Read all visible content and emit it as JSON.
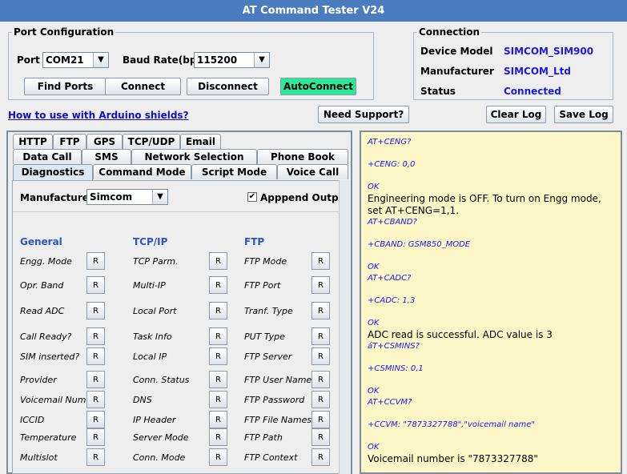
{
  "window": {
    "title": "AT Command Tester V24"
  },
  "port_config": {
    "legend": "Port Configuration",
    "port_label": "Port",
    "port_value": "COM21",
    "baud_label": "Baud Rate(bps)",
    "baud_value": "115200",
    "find_ports": "Find Ports",
    "connect": "Connect",
    "disconnect": "Disconnect",
    "autoconnect": "AutoConnect"
  },
  "connection": {
    "legend": "Connection",
    "device_model_label": "Device Model",
    "device_model_value": "SIMCOM_SIM900",
    "manufacturer_label": "Manufacturer",
    "manufacturer_value": "SIMCOM_Ltd",
    "status_label": "Status",
    "status_value": "Connected"
  },
  "links": {
    "arduino": "How to use with Arduino shields?"
  },
  "buttons": {
    "need_support": "Need Support?",
    "clear_log": "Clear Log",
    "save_log": "Save Log"
  },
  "tabs": {
    "row1": [
      "HTTP",
      "FTP",
      "GPS",
      "TCP/UDP",
      "Email"
    ],
    "row2": [
      "Data Call",
      "SMS",
      "Network Selection",
      "Phone Book"
    ],
    "row3": [
      "Diagnostics",
      "Command Mode",
      "Script Mode",
      "Voice Call"
    ],
    "selected": "Diagnostics"
  },
  "diagnostics": {
    "manufacturer_label": "Manufacturer",
    "manufacturer_value": "Simcom",
    "append_output_label": "Apppend Output",
    "append_output_checked": true,
    "button_label": "R",
    "columns": [
      {
        "header": "General",
        "items": [
          "Engg. Mode",
          "Opr. Band",
          "Read ADC",
          "Call Ready?",
          "SIM inserted?",
          "Provider",
          "Voicemail Num.",
          "ICCID",
          "Temperature",
          "Multislot"
        ]
      },
      {
        "header": "TCP/IP",
        "items": [
          "TCP Parm.",
          "Multi-IP",
          "Local Port",
          "Task Info",
          "Local IP",
          "Conn. Status",
          "DNS",
          "IP Header",
          "Server Mode",
          "Conn. Mode"
        ]
      },
      {
        "header": "FTP",
        "items": [
          "FTP Mode",
          "FTP Port",
          "Tranf. Type",
          "PUT Type",
          "FTP Server",
          "FTP User Name",
          "FTP Password",
          "FTP  File Names",
          "FTP Path",
          "FTP Context"
        ]
      }
    ]
  },
  "log": {
    "lines": [
      {
        "t": "cmd",
        "text": "AT+CENG?"
      },
      {
        "t": "gap",
        "text": ""
      },
      {
        "t": "cmd",
        "text": "+CENG: 0,0"
      },
      {
        "t": "gap",
        "text": ""
      },
      {
        "t": "cmd",
        "text": "OK"
      },
      {
        "t": "info",
        "text": "Engineering mode is OFF. To turn on Engg mode, set AT+CENG=1,1."
      },
      {
        "t": "cmd",
        "text": "AT+CBAND?"
      },
      {
        "t": "gap",
        "text": ""
      },
      {
        "t": "cmd",
        "text": "+CBAND: GSM850_MODE"
      },
      {
        "t": "gap",
        "text": ""
      },
      {
        "t": "cmd",
        "text": "OK"
      },
      {
        "t": "cmd",
        "text": "AT+CADC?"
      },
      {
        "t": "gap",
        "text": ""
      },
      {
        "t": "cmd",
        "text": "+CADC: 1,3"
      },
      {
        "t": "gap",
        "text": ""
      },
      {
        "t": "cmd",
        "text": "OK"
      },
      {
        "t": "info",
        "text": "ADC read is successful. ADC value is  3"
      },
      {
        "t": "cmd",
        "text": "áT+CSMINS?"
      },
      {
        "t": "gap",
        "text": ""
      },
      {
        "t": "cmd",
        "text": "+CSMINS: 0,1"
      },
      {
        "t": "gap",
        "text": ""
      },
      {
        "t": "cmd",
        "text": "OK"
      },
      {
        "t": "cmd",
        "text": "AT+CCVM?"
      },
      {
        "t": "gap",
        "text": ""
      },
      {
        "t": "cmd",
        "text": "+CCVM: \"7873327788\",\"voicemail name\""
      },
      {
        "t": "gap",
        "text": ""
      },
      {
        "t": "cmd",
        "text": "OK"
      },
      {
        "t": "info",
        "text": "Voicemail number is \"7873327788\""
      }
    ]
  }
}
